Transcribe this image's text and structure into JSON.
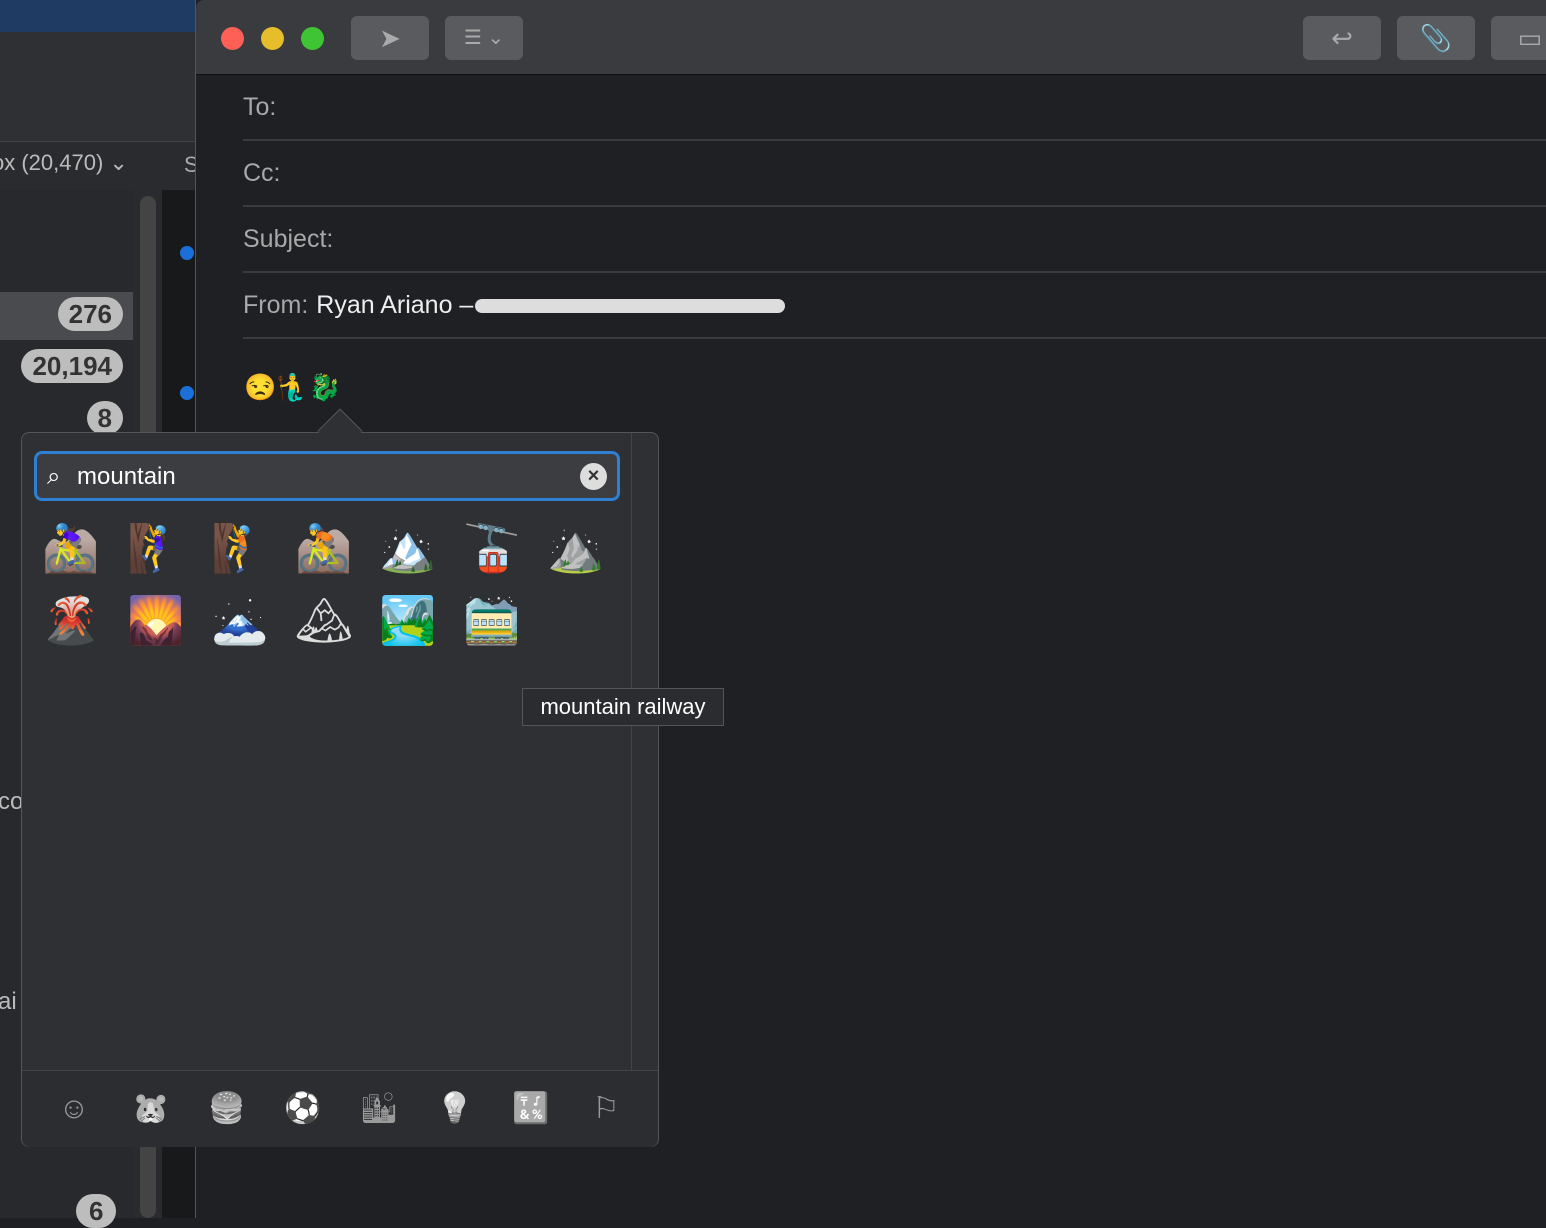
{
  "background_window": {
    "mailbox_label": "ox (20,470) ⌄",
    "badges": [
      "276",
      "20,194",
      "8",
      "6"
    ],
    "partial_texts": [
      "S",
      "co",
      "ai"
    ]
  },
  "compose": {
    "toolbar": {
      "send_icon": "paper-plane-icon",
      "format_icon": "list-icon",
      "reply_icon": "reply-arrow-icon",
      "attach_icon": "paperclip-icon"
    },
    "fields": {
      "to_label": "To:",
      "cc_label": "Cc:",
      "subject_label": "Subject:",
      "from_label": "From:",
      "from_value": "Ryan Ariano –"
    },
    "body_text": "😒🧜‍♂️🐉"
  },
  "emoji_picker": {
    "search_value": "mountain",
    "results": [
      "🚵‍♀️",
      "🧗‍♀️",
      "🧗",
      "🚵",
      "🏔️",
      "🚡",
      "⛰️",
      "🌋",
      "🌄",
      "🗻",
      "🏔",
      "🏞️",
      "🚞"
    ],
    "tooltip": "mountain railway",
    "categories": [
      {
        "name": "smileys",
        "glyph": "☺"
      },
      {
        "name": "animals",
        "glyph": "🐹"
      },
      {
        "name": "food",
        "glyph": "🍔"
      },
      {
        "name": "activity",
        "glyph": "⚽"
      },
      {
        "name": "travel",
        "glyph": "🏙"
      },
      {
        "name": "objects",
        "glyph": "💡"
      },
      {
        "name": "symbols",
        "glyph": "🔣"
      },
      {
        "name": "flags",
        "glyph": "⚐"
      }
    ]
  },
  "colors": {
    "close": "#fe5f57",
    "minimize": "#e6bd2b",
    "zoom": "#3fc434",
    "search_focus": "#2f7fd4"
  }
}
